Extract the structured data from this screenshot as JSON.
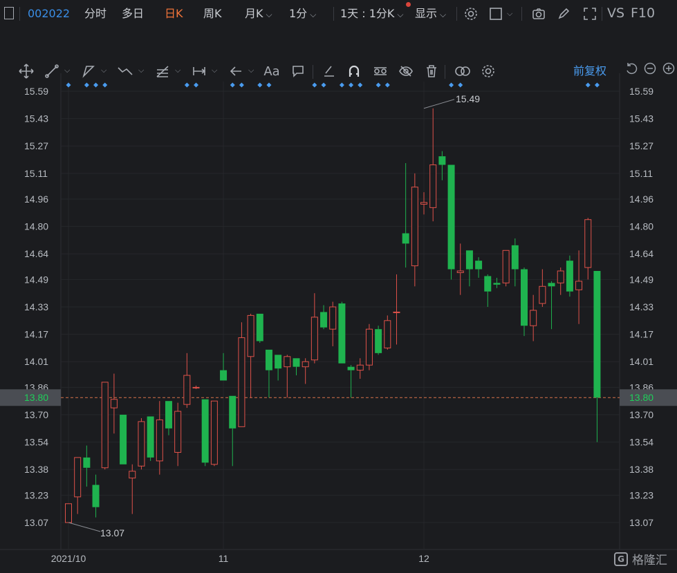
{
  "toolbar": {
    "stock_code": "002022",
    "tabs": [
      "分时",
      "多日",
      "日K",
      "周K",
      "月K",
      "1分"
    ],
    "active_tab": "日K",
    "multi_period": "1天 : 1分K",
    "display_label": "显示",
    "vs_label": "VS",
    "f10_label": "F10"
  },
  "chart_header": {
    "adjust_label": "前复权"
  },
  "brand": {
    "name": "格隆汇"
  },
  "colors": {
    "up": "#e0524a",
    "down": "#1fb34f",
    "accent": "#3a8ee6",
    "active_tab": "#f2743a",
    "current_price_line": "#d9734a"
  },
  "icons": [
    "crosshair-icon",
    "line-tool-icon",
    "channel-tool-icon",
    "polyline-tool-icon",
    "fib-tool-icon",
    "measure-tool-icon",
    "arrow-tool-icon",
    "text-tool-icon",
    "comment-tool-icon",
    "pencil-icon",
    "magnet-icon",
    "hide-drawings-icon",
    "eye-off-icon",
    "trash-icon",
    "link-icon",
    "settings-icon",
    "camera-icon",
    "fullscreen-icon",
    "reset-icon",
    "zoom-out-icon",
    "zoom-in-icon"
  ],
  "chart_data": {
    "type": "candlestick",
    "y_ticks": [
      15.59,
      15.43,
      15.27,
      15.11,
      14.96,
      14.8,
      14.64,
      14.49,
      14.33,
      14.17,
      14.01,
      13.86,
      13.7,
      13.54,
      13.38,
      13.23,
      13.07
    ],
    "x_ticks": [
      {
        "label": "2021/10",
        "index": 0
      },
      {
        "label": "11",
        "index": 17
      },
      {
        "label": "12",
        "index": 39
      }
    ],
    "current_price": 13.8,
    "max_label": {
      "value": "15.49",
      "index": 39
    },
    "min_label": {
      "value": "13.07",
      "index": 0
    },
    "event_marker_indices": [
      0,
      2,
      3,
      4,
      13,
      14,
      18,
      19,
      21,
      22,
      27,
      28,
      30,
      31,
      32,
      34,
      35,
      42,
      43,
      57,
      58
    ],
    "candles": [
      {
        "o": 13.07,
        "h": 13.18,
        "l": 13.07,
        "c": 13.18
      },
      {
        "o": 13.22,
        "h": 13.45,
        "l": 13.12,
        "c": 13.45
      },
      {
        "o": 13.45,
        "h": 13.52,
        "l": 13.28,
        "c": 13.39
      },
      {
        "o": 13.29,
        "h": 13.35,
        "l": 13.1,
        "c": 13.16
      },
      {
        "o": 13.39,
        "h": 13.89,
        "l": 13.38,
        "c": 13.89
      },
      {
        "o": 13.74,
        "h": 13.94,
        "l": 13.59,
        "c": 13.79
      },
      {
        "o": 13.7,
        "h": 13.7,
        "l": 13.41,
        "c": 13.41
      },
      {
        "o": 13.33,
        "h": 13.41,
        "l": 13.12,
        "c": 13.37
      },
      {
        "o": 13.4,
        "h": 13.68,
        "l": 13.38,
        "c": 13.66
      },
      {
        "o": 13.69,
        "h": 13.69,
        "l": 13.43,
        "c": 13.45
      },
      {
        "o": 13.43,
        "h": 13.78,
        "l": 13.35,
        "c": 13.67
      },
      {
        "o": 13.78,
        "h": 13.78,
        "l": 13.58,
        "c": 13.62
      },
      {
        "o": 13.48,
        "h": 13.77,
        "l": 13.4,
        "c": 13.72
      },
      {
        "o": 13.76,
        "h": 14.06,
        "l": 13.74,
        "c": 13.93
      },
      {
        "o": 13.86,
        "h": 13.87,
        "l": 13.85,
        "c": 13.86
      },
      {
        "o": 13.79,
        "h": 13.79,
        "l": 13.4,
        "c": 13.42
      },
      {
        "o": 13.41,
        "h": 13.78,
        "l": 13.4,
        "c": 13.78
      },
      {
        "o": 13.96,
        "h": 14.06,
        "l": 13.9,
        "c": 13.9
      },
      {
        "o": 13.81,
        "h": 13.81,
        "l": 13.4,
        "c": 13.62
      },
      {
        "o": 13.63,
        "h": 14.24,
        "l": 13.63,
        "c": 14.15
      },
      {
        "o": 14.04,
        "h": 14.29,
        "l": 13.8,
        "c": 14.28
      },
      {
        "o": 14.29,
        "h": 14.29,
        "l": 14.12,
        "c": 14.13
      },
      {
        "o": 14.08,
        "h": 14.08,
        "l": 13.8,
        "c": 13.96
      },
      {
        "o": 14.05,
        "h": 14.05,
        "l": 13.9,
        "c": 13.97
      },
      {
        "o": 13.98,
        "h": 14.05,
        "l": 13.8,
        "c": 14.04
      },
      {
        "o": 14.03,
        "h": 14.03,
        "l": 13.93,
        "c": 13.98
      },
      {
        "o": 13.98,
        "h": 14.03,
        "l": 13.88,
        "c": 14.01
      },
      {
        "o": 14.02,
        "h": 14.41,
        "l": 14.0,
        "c": 14.27
      },
      {
        "o": 14.3,
        "h": 14.34,
        "l": 14.2,
        "c": 14.21
      },
      {
        "o": 14.2,
        "h": 14.36,
        "l": 14.1,
        "c": 14.33
      },
      {
        "o": 14.35,
        "h": 14.36,
        "l": 14.0,
        "c": 14.0
      },
      {
        "o": 13.98,
        "h": 13.99,
        "l": 13.8,
        "c": 13.96
      },
      {
        "o": 13.96,
        "h": 14.03,
        "l": 13.91,
        "c": 13.99
      },
      {
        "o": 13.99,
        "h": 14.23,
        "l": 13.96,
        "c": 14.2
      },
      {
        "o": 14.2,
        "h": 14.22,
        "l": 14.05,
        "c": 14.06
      },
      {
        "o": 14.09,
        "h": 14.28,
        "l": 14.08,
        "c": 14.25
      },
      {
        "o": 14.3,
        "h": 14.52,
        "l": 14.11,
        "c": 14.3
      },
      {
        "o": 14.76,
        "h": 15.17,
        "l": 14.56,
        "c": 14.7
      },
      {
        "o": 14.57,
        "h": 15.11,
        "l": 14.45,
        "c": 15.03
      },
      {
        "o": 14.93,
        "h": 15.0,
        "l": 14.87,
        "c": 14.94
      },
      {
        "o": 14.91,
        "h": 15.49,
        "l": 14.83,
        "c": 15.16
      },
      {
        "o": 15.21,
        "h": 15.24,
        "l": 15.07,
        "c": 15.16
      },
      {
        "o": 15.16,
        "h": 15.16,
        "l": 14.49,
        "c": 14.55
      },
      {
        "o": 14.53,
        "h": 14.7,
        "l": 14.4,
        "c": 14.54
      },
      {
        "o": 14.66,
        "h": 14.66,
        "l": 14.45,
        "c": 14.55
      },
      {
        "o": 14.6,
        "h": 14.62,
        "l": 14.5,
        "c": 14.55
      },
      {
        "o": 14.51,
        "h": 14.52,
        "l": 14.33,
        "c": 14.42
      },
      {
        "o": 14.47,
        "h": 14.5,
        "l": 14.44,
        "c": 14.46
      },
      {
        "o": 14.47,
        "h": 14.66,
        "l": 14.45,
        "c": 14.66
      },
      {
        "o": 14.69,
        "h": 14.73,
        "l": 14.45,
        "c": 14.55
      },
      {
        "o": 14.55,
        "h": 14.56,
        "l": 14.16,
        "c": 14.22
      },
      {
        "o": 14.22,
        "h": 14.4,
        "l": 14.13,
        "c": 14.31
      },
      {
        "o": 14.35,
        "h": 14.55,
        "l": 14.33,
        "c": 14.45
      },
      {
        "o": 14.47,
        "h": 14.48,
        "l": 14.2,
        "c": 14.45
      },
      {
        "o": 14.47,
        "h": 14.56,
        "l": 14.4,
        "c": 14.54
      },
      {
        "o": 14.6,
        "h": 14.63,
        "l": 14.39,
        "c": 14.42
      },
      {
        "o": 14.43,
        "h": 14.66,
        "l": 14.23,
        "c": 14.48
      },
      {
        "o": 14.56,
        "h": 14.85,
        "l": 14.49,
        "c": 14.84
      },
      {
        "o": 14.54,
        "h": 14.54,
        "l": 13.54,
        "c": 13.8
      }
    ]
  }
}
